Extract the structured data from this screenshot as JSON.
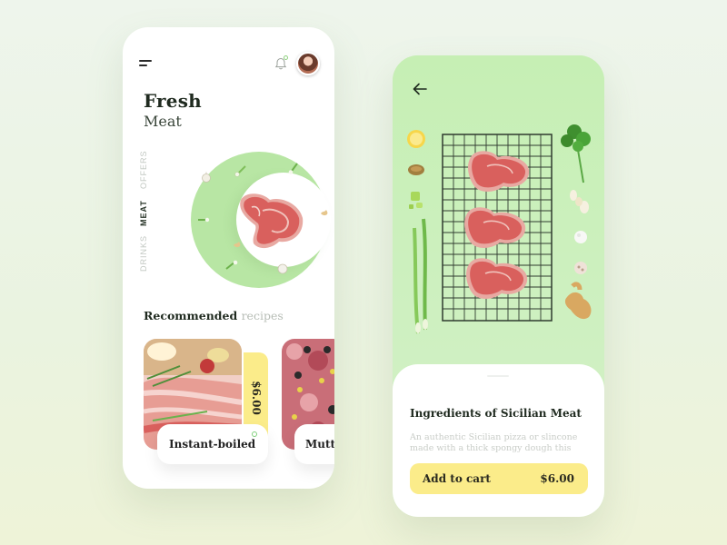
{
  "home": {
    "title": "Fresh",
    "subtitle": "Meat",
    "tabs": [
      {
        "label": "OFFERS",
        "active": false
      },
      {
        "label": "MEAT",
        "active": true
      },
      {
        "label": "DRINKS",
        "active": false
      }
    ],
    "recommended": {
      "title": "Recommended",
      "title_muted": "recipes"
    },
    "cards": [
      {
        "name": "Instant-boiled",
        "price": "$6.00"
      },
      {
        "name": "Mutto"
      }
    ],
    "icons": [
      "menu-icon",
      "bell-icon",
      "avatar"
    ]
  },
  "detail": {
    "title": "Ingredients of Sicilian Meat",
    "description": "An authentic Sicilian pizza or slincone made with a thick spongy dough this mixture of",
    "cart": {
      "label": "Add to cart",
      "price": "$6.00"
    },
    "icons": [
      "back-arrow-icon"
    ]
  },
  "colors": {
    "accent_green": "#b8e6a4",
    "accent_yellow": "#fbec8a",
    "meat": "#d95f5f",
    "panel_green": "#ccf0bc"
  }
}
